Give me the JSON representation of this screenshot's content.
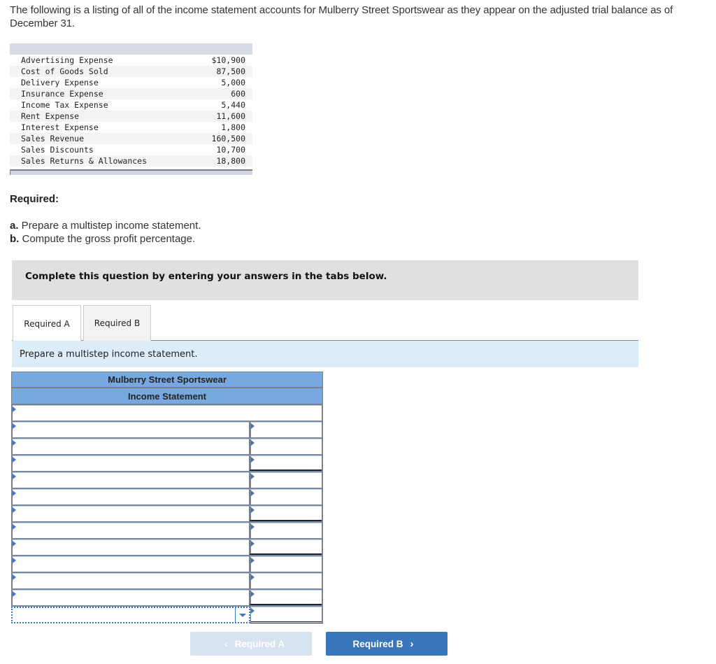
{
  "intro": "The following is a listing of all of the income statement accounts for Mulberry Street Sportswear as they appear on the adjusted trial balance as of December 31.",
  "trial_balance": [
    {
      "account": "Advertising Expense",
      "amount": "$10,900"
    },
    {
      "account": "Cost of Goods Sold",
      "amount": "87,500"
    },
    {
      "account": "Delivery Expense",
      "amount": "5,000"
    },
    {
      "account": "Insurance Expense",
      "amount": "600"
    },
    {
      "account": "Income Tax Expense",
      "amount": "5,440"
    },
    {
      "account": "Rent Expense",
      "amount": "11,600"
    },
    {
      "account": "Interest Expense",
      "amount": "1,800"
    },
    {
      "account": "Sales Revenue",
      "amount": "160,500"
    },
    {
      "account": "Sales Discounts",
      "amount": "10,700"
    },
    {
      "account": "Sales Returns & Allowances",
      "amount": "18,800"
    }
  ],
  "required": {
    "title": "Required:",
    "a_label": "a.",
    "a_text": " Prepare a multistep income statement.",
    "b_label": "b.",
    "b_text": " Compute the gross profit percentage."
  },
  "banner": "Complete this question by entering your answers in the tabs below.",
  "tabs": [
    {
      "label": "Required A",
      "active": true
    },
    {
      "label": "Required B",
      "active": false
    }
  ],
  "instruction": "Prepare a multistep income statement.",
  "statement": {
    "company": "Mulberry Street Sportswear",
    "title": "Income Statement",
    "rows": [
      {
        "label": "",
        "amount": ""
      },
      {
        "label": "",
        "amount": ""
      },
      {
        "label": "",
        "amount": ""
      },
      {
        "label": "",
        "amount": ""
      },
      {
        "label": "",
        "amount": ""
      },
      {
        "label": "",
        "amount": ""
      },
      {
        "label": "",
        "amount": ""
      },
      {
        "label": "",
        "amount": ""
      },
      {
        "label": "",
        "amount": ""
      },
      {
        "label": "",
        "amount": ""
      },
      {
        "label": "",
        "amount": ""
      },
      {
        "label": "",
        "amount": ""
      }
    ],
    "select_row": {
      "selected": "",
      "amount": ""
    }
  },
  "nav": {
    "prev_label": "Required A",
    "prev_icon": "‹",
    "next_label": "Required B",
    "next_icon": "›"
  }
}
